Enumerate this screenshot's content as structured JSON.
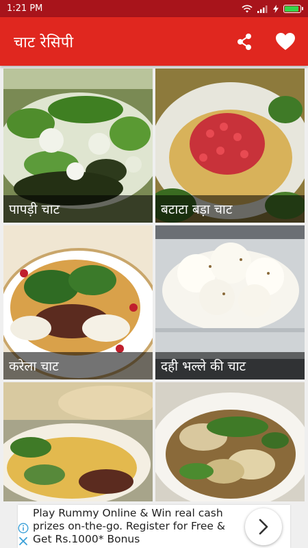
{
  "status_bar": {
    "time": "1:21 PM",
    "battery_level": 0.9,
    "battery_color": "#36d34a"
  },
  "app_bar": {
    "title": "चाट रेसिपी",
    "color": "#e0271f",
    "share_icon": "share-icon",
    "favorite_icon": "heart-icon"
  },
  "recipes": [
    {
      "label": "पापड़ी चाट"
    },
    {
      "label": "बटाटा बड़ा चाट"
    },
    {
      "label": "करेला चाट"
    },
    {
      "label": "दही भल्ले की चाट"
    },
    {
      "label": ""
    },
    {
      "label": ""
    }
  ],
  "ad": {
    "text": "Play Rummy Online & Win real cash prizes on-the-go. Register for Free & Get Rs.1000* Bonus",
    "info_icon": "info-icon",
    "close_icon": "close-icon",
    "next_icon": "chevron-right-icon"
  }
}
